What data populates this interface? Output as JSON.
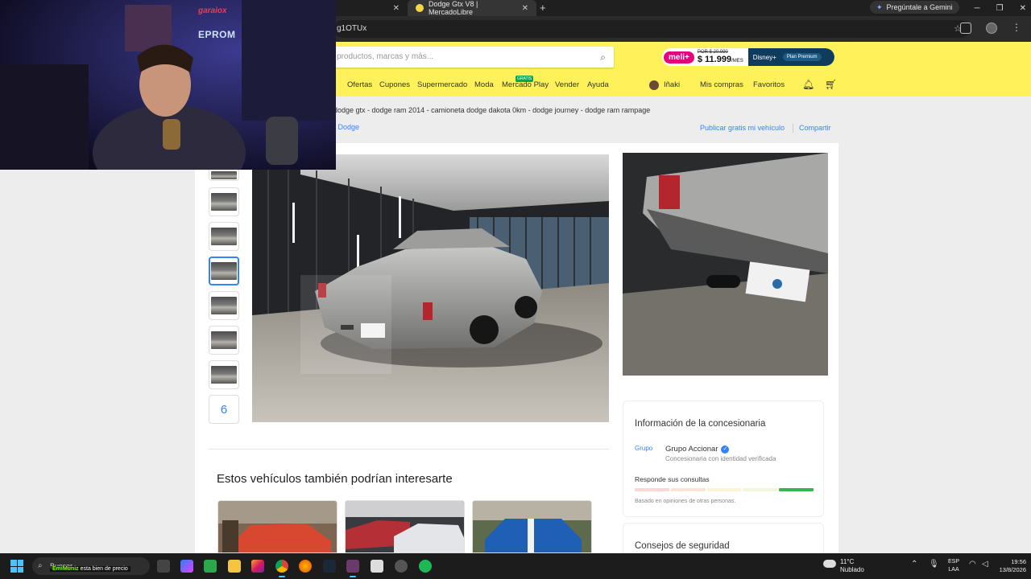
{
  "browser": {
    "tabs": [
      {
        "label": ""
      },
      {
        "label": "Dodge Gtx V8 | MercadoLibre"
      }
    ],
    "new_tab_glyph": "+",
    "close_glyph": "✕",
    "gemini_label": "Pregúntale a Gemini",
    "url_fragment": "g1OTUx",
    "icons": [
      "star-icon",
      "extensions-icon",
      "profile-icon"
    ]
  },
  "header": {
    "search_placeholder": "productos, marcas y más...",
    "meli_badge": "meli+",
    "meli_old_price": "POR $ 20.990",
    "meli_price": "$ 11.999",
    "meli_period": "/MES",
    "disney_label": "Disney+",
    "plan_label": "Plan Premium",
    "nav_items": [
      "Ofertas",
      "Cupones",
      "Supermercado",
      "Moda",
      "Mercado Play",
      "Vender",
      "Ayuda"
    ],
    "gratis_badge": "GRATIS",
    "user_name": "Iñaki",
    "user_links": [
      "Mis compras",
      "Favoritos"
    ]
  },
  "page": {
    "related_searches": "dodge gtx - dodge ram 2014 - camioneta dodge dakota 0km - dodge journey - dodge ram rampage",
    "breadcrumb_sep": "›",
    "breadcrumb_last": "Dodge",
    "publish_link": "Publicar gratis mi vehículo",
    "share_link": "Compartir",
    "more_photos_count": "6",
    "section_title": "Estos vehículos también podrían interesarte",
    "dealer": {
      "title": "Información de la concesionaria",
      "logo_alt": "Grupo",
      "name": "Grupo Accionar",
      "verified_glyph": "✓",
      "subtitle": "Concesionaria con identidad verificada",
      "responds": "Responde sus consultas",
      "note": "Basado en opiniones de otras personas.",
      "thermometer_level": 5,
      "thermometer_colors": [
        "#fdd6d6",
        "#fde3d4",
        "#fef1d6",
        "#f1f6dd",
        "#39b54a"
      ]
    },
    "tips_title": "Consejos de seguridad"
  },
  "overlay": {
    "label1": "garaiox",
    "label2": "EPROM"
  },
  "taskbar": {
    "search_label": "Buscar",
    "chat_user": "EmiMuniz",
    "chat_text": "esta bien de precio",
    "temperature": "11°C",
    "weather": "Nublado",
    "lang1": "ESP",
    "lang2": "LAA",
    "time": "19:56",
    "date": "13/8/2026"
  },
  "colors": {
    "ml_yellow": "#fff159",
    "ml_blue": "#3483fa",
    "meli_pink": "#e6007e"
  }
}
